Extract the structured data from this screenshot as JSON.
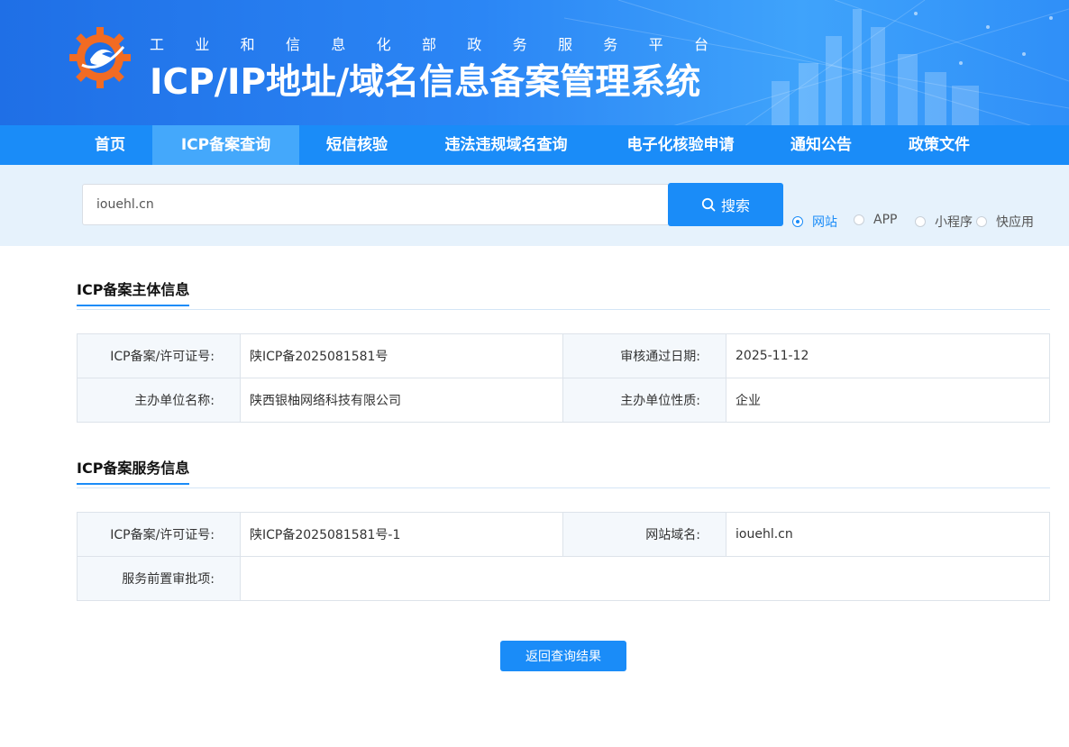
{
  "header": {
    "subtitle": [
      "工",
      "业",
      "和",
      "信",
      "息",
      "化",
      "部",
      "政",
      "务",
      "服",
      "务",
      "平",
      "台"
    ],
    "title": "ICP/IP地址/域名信息备案管理系统"
  },
  "nav": {
    "items": [
      {
        "label": "首页"
      },
      {
        "label": "ICP备案查询",
        "active": true
      },
      {
        "label": "短信核验"
      },
      {
        "label": "违法违规域名查询"
      },
      {
        "label": "电子化核验申请"
      },
      {
        "label": "通知公告"
      },
      {
        "label": "政策文件"
      }
    ]
  },
  "search": {
    "value": "iouehl.cn",
    "button_label": "搜索",
    "options": [
      {
        "label": "网站",
        "checked": true
      },
      {
        "label": "APP"
      },
      {
        "label": "小程序"
      },
      {
        "label": "快应用"
      }
    ]
  },
  "subject": {
    "title": "ICP备案主体信息",
    "license_key": "ICP备案/许可证号:",
    "license_value": "陕ICP备2025081581号",
    "date_key": "审核通过日期:",
    "date_value": "2025-11-12",
    "org_key": "主办单位名称:",
    "org_value": "陕西银柚网络科技有限公司",
    "nature_key": "主办单位性质:",
    "nature_value": "企业"
  },
  "service": {
    "title": "ICP备案服务信息",
    "license_key": "ICP备案/许可证号:",
    "license_value": "陕ICP备2025081581号-1",
    "domain_key": "网站域名:",
    "domain_value": "iouehl.cn",
    "approval_key": "服务前置审批项:",
    "approval_value": ""
  },
  "back_button": "返回查询结果",
  "colors": {
    "primary": "#1a8cf8",
    "nav_active": "#44a8fb",
    "band": "#e6f2fc"
  }
}
